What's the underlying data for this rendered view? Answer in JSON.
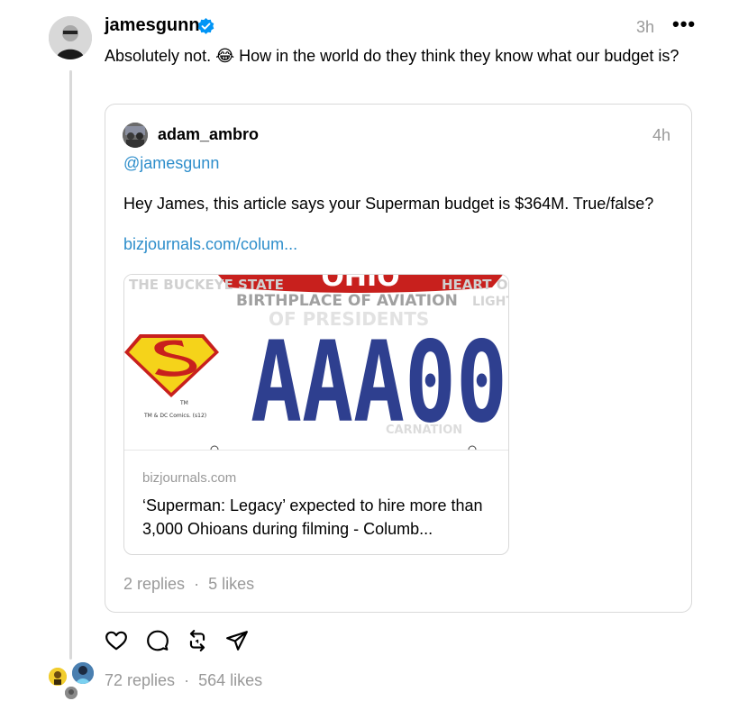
{
  "post": {
    "username": "jamesgunn",
    "time": "3h",
    "text": "Absolutely not. 😂 How in the world do they think they know what our budget is?",
    "stats": {
      "replies": "72 replies",
      "separator": "·",
      "likes": "564 likes"
    }
  },
  "quote": {
    "username": "adam_ambro",
    "time": "4h",
    "mention": "@jamesgunn",
    "body": "Hey James, this article says your Superman budget is $364M. True/false?",
    "link": "bizjournals.com/colum...",
    "link_card": {
      "image": {
        "top_banner": "OHIO",
        "header_text": "THE BUCKEYE STATE",
        "header_text_right": "HEART OF",
        "subheader": "BIRTHPLACE OF AVIATION",
        "subheader_right": "LIGHT",
        "bg_words": "OF PRESIDENTS",
        "bg_words_bottom": "CARNATION",
        "plate_number": "AAA00",
        "trademark": "TM",
        "copyright": "TM & DC Comics. (s12)"
      },
      "domain": "bizjournals.com",
      "title": "‘Superman: Legacy’ expected to hire more than 3,000 Ohioans during filming - Columb..."
    },
    "stats": {
      "replies": "2 replies",
      "separator": "·",
      "likes": "5 likes"
    }
  },
  "icons": {
    "like": "heart-icon",
    "reply": "comment-icon",
    "repost": "repost-icon",
    "share": "send-icon",
    "more": "more-icon",
    "verified": "verified-badge-icon"
  },
  "colors": {
    "link": "#2e8ecb",
    "muted": "#999999",
    "verified": "#0095f6",
    "plate_blue": "#2e3f8f",
    "banner_red": "#c8201d"
  }
}
